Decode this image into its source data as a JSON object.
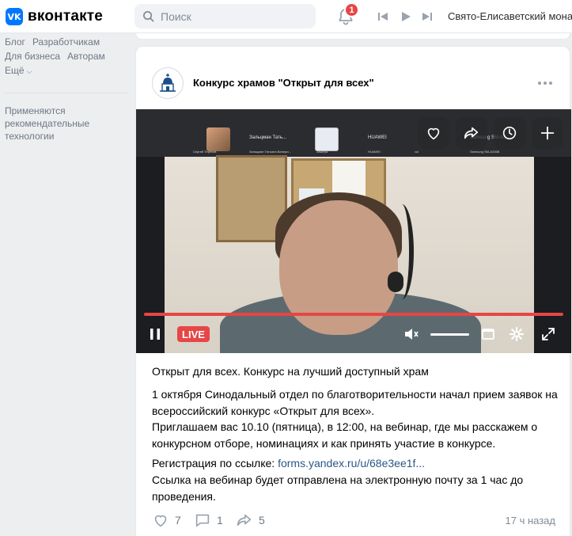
{
  "header": {
    "logo_text": "вконтакте",
    "logo_mark": "VK",
    "search_placeholder": "Поиск",
    "notifications_count": "1",
    "now_playing": "Свято-Елисаветский мона"
  },
  "sidebar": {
    "links_row1": [
      "Блог",
      "Разработчикам"
    ],
    "links_row2": [
      "Для бизнеса",
      "Авторам"
    ],
    "more": "Ещё",
    "note": "Применяются рекомендательные технологии"
  },
  "post": {
    "title": "Конкурс храмов \"Открыт для всех\"",
    "video": {
      "live_label": "LIVE",
      "strip_names": [
        "Зальцман Тать...",
        "HUAWEI",
        "Samsung SM-A3..."
      ],
      "strip_subs": [
        "Сергей Терехов",
        "Зальцман Татьяна Валери...",
        "Заштра",
        "HUAWEI",
        "vol",
        "Samsung SM-A336B"
      ],
      "progress_fraction": 1.0,
      "volume_fraction": 1.0
    },
    "lines": [
      "Открыт для всех. Конкурс на лучший доступный храм",
      "1 октября Синодальный отдел по благотворительности начал прием заявок на всероссийский конкурс «Открыт для всех».",
      "Приглашаем вас 10.10 (пятница), в 12:00, на вебинар, где мы расскажем о конкурсном отборе, номинациях и как принять участие в конкурсе.",
      "Регистрация по ссылке: ",
      "forms.yandex.ru/u/68e3ee1f...",
      "Ссылка на вебинар будет отправлена на электронную почту за 1 час до проведения."
    ],
    "likes": "7",
    "comments": "1",
    "shares": "5",
    "time": "17 ч назад"
  },
  "colors": {
    "accent": "#0077ff",
    "live": "#e64646",
    "link": "#2a5885"
  }
}
